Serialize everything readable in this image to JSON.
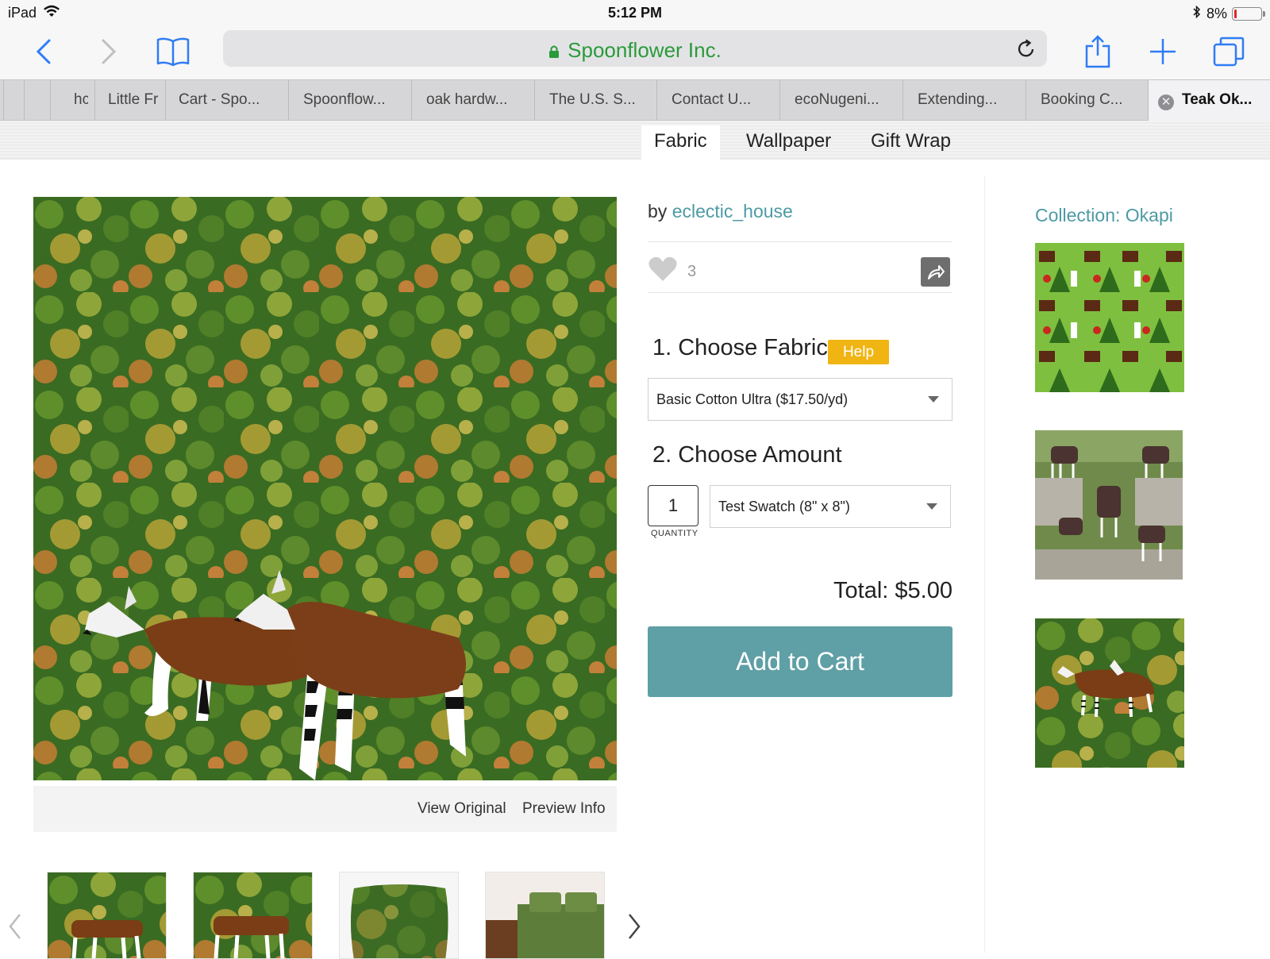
{
  "status": {
    "device": "iPad",
    "time": "5:12 PM",
    "battery_pct": "8%",
    "battery_level": 0.08
  },
  "browser": {
    "url_title": "Spoonflower Inc.",
    "tabs": [
      "hc",
      "Little Fr",
      "Cart - Spo...",
      "Spoonflow...",
      "oak hardw...",
      "The U.S. S...",
      "Contact U...",
      "ecoNugeni...",
      "Extending...",
      "Booking C...",
      "Teak Ok..."
    ],
    "close_tab_symbol": "✕"
  },
  "site_nav": [
    "Fabric",
    "Wallpaper",
    "Gift Wrap"
  ],
  "main": {
    "view_original": "View Original",
    "preview_info": "Preview Info"
  },
  "product": {
    "by": "by",
    "designer": "eclectic_house",
    "like_count": "3",
    "step1": "1. Choose Fabric",
    "help": "Help",
    "fabric_selected": "Basic Cotton Ultra ($17.50/yd)",
    "step2": "2. Choose Amount",
    "quantity": "1",
    "quantity_label": "QUANTITY",
    "amount_selected": "Test Swatch (8\" x 8\")",
    "total": "Total: $5.00",
    "add_to_cart": "Add to Cart"
  },
  "sidebar": {
    "collection_title": "Collection: Okapi"
  },
  "colors": {
    "accent_teal": "#5f9fa6",
    "link_teal": "#4d9aa5",
    "help_yellow": "#f0b413",
    "url_green": "#2a9a3a",
    "ios_blue": "#2f7cf6"
  }
}
